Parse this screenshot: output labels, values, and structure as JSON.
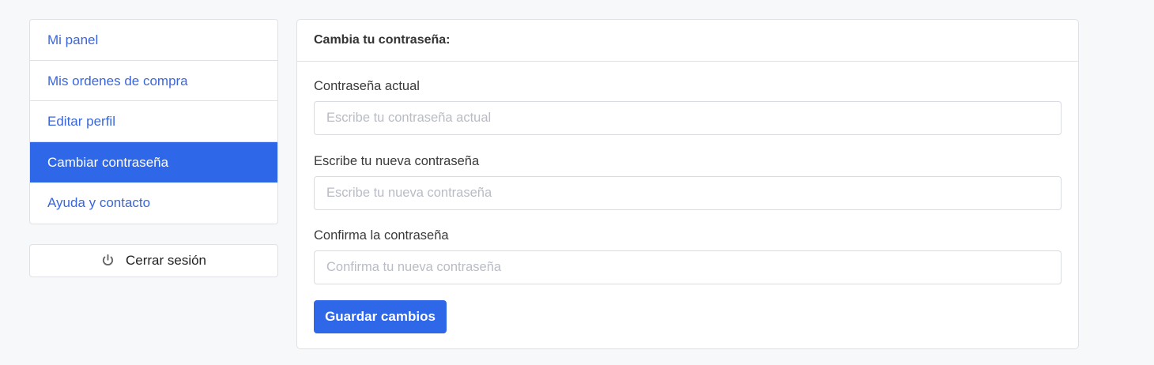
{
  "sidebar": {
    "items": [
      {
        "label": "Mi panel",
        "active": false
      },
      {
        "label": "Mis ordenes de compra",
        "active": false
      },
      {
        "label": "Editar perfil",
        "active": false
      },
      {
        "label": "Cambiar contraseña",
        "active": true
      },
      {
        "label": "Ayuda y contacto",
        "active": false
      }
    ],
    "logout": {
      "label": "Cerrar sesión",
      "icon": "power-icon"
    }
  },
  "form": {
    "title": "Cambia tu contraseña:",
    "fields": [
      {
        "label": "Contraseña actual",
        "placeholder": "Escribe tu contraseña actual",
        "value": ""
      },
      {
        "label": "Escribe tu nueva contraseña",
        "placeholder": "Escribe tu nueva contraseña",
        "value": ""
      },
      {
        "label": "Confirma la contraseña",
        "placeholder": "Confirma tu nueva contraseña",
        "value": ""
      }
    ],
    "submit_label": "Guardar cambios"
  },
  "colors": {
    "accent": "#2f67e9",
    "link": "#3a66db",
    "background": "#f7f8fa",
    "border": "#dfe1e5"
  }
}
